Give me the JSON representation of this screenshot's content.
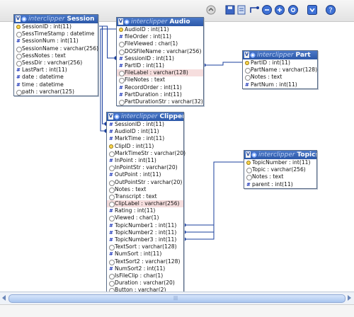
{
  "toolbar": {
    "icons": [
      "refresh-icon",
      "save-icon",
      "export-icon",
      "relation-icon",
      "zoom-out-icon",
      "zoom-in-icon",
      "zoom-reset-icon",
      "options-icon",
      "help-icon"
    ]
  },
  "colors": {
    "header_top": "#4a78c8",
    "header_bottom": "#2c58a8",
    "relation_line": "#1a3f9e",
    "highlight_row": "#f6dede"
  },
  "tables": {
    "session": {
      "db": "interclipper",
      "name": "Session",
      "columns": [
        {
          "icon": "key",
          "text": "SessionID : int(11)"
        },
        {
          "icon": "circle",
          "text": "SessTimeStamp : datetime"
        },
        {
          "icon": "hash",
          "text": "SessionNum : int(11)"
        },
        {
          "icon": "circle",
          "text": "SessionName : varchar(256)"
        },
        {
          "icon": "circle",
          "text": "SessNotes : text"
        },
        {
          "icon": "circle",
          "text": "SessDir : varchar(256)"
        },
        {
          "icon": "hash",
          "text": "LastPart : int(11)"
        },
        {
          "icon": "hash",
          "text": "date : datetime"
        },
        {
          "icon": "hash",
          "text": "time : datetime"
        },
        {
          "icon": "circle",
          "text": "path : varchar(125)"
        }
      ]
    },
    "audio": {
      "db": "interclipper",
      "name": "Audio",
      "columns": [
        {
          "icon": "key",
          "text": "AudioID : int(11)"
        },
        {
          "icon": "hash",
          "text": "fileOrder : int(11)"
        },
        {
          "icon": "circle",
          "text": "FileViewed : char(1)"
        },
        {
          "icon": "circle",
          "text": "DOSFileName : varchar(256)"
        },
        {
          "icon": "hash",
          "text": "SessionID : int(11)"
        },
        {
          "icon": "hash",
          "text": "PartID : int(11)"
        },
        {
          "icon": "circle",
          "text": "FileLabel : varchar(128)",
          "hl": true
        },
        {
          "icon": "circle",
          "text": "FileNotes : text"
        },
        {
          "icon": "hash",
          "text": "RecordOrder : int(11)"
        },
        {
          "icon": "hash",
          "text": "PartDuration : int(11)"
        },
        {
          "icon": "circle",
          "text": "PartDurationStr : varchar(32)"
        }
      ]
    },
    "part": {
      "db": "interclipper",
      "name": "Part",
      "columns": [
        {
          "icon": "key",
          "text": "PartID : int(11)"
        },
        {
          "icon": "circle",
          "text": "PartName : varchar(128)"
        },
        {
          "icon": "circle",
          "text": "Notes : text"
        },
        {
          "icon": "hash",
          "text": "PartNum : int(11)"
        }
      ]
    },
    "clipper": {
      "db": "interclipper",
      "name": "Clipper",
      "columns": [
        {
          "icon": "hash",
          "text": "SessionID : int(11)"
        },
        {
          "icon": "hash",
          "text": "AudioID : int(11)"
        },
        {
          "icon": "hash",
          "text": "MarkTime : int(11)"
        },
        {
          "icon": "key",
          "text": "ClipID : int(11)"
        },
        {
          "icon": "circle",
          "text": "MarkTimeStr : varchar(20)"
        },
        {
          "icon": "hash",
          "text": "InPoint : int(11)"
        },
        {
          "icon": "circle",
          "text": "InPointStr : varchar(20)"
        },
        {
          "icon": "hash",
          "text": "OutPoint : int(11)"
        },
        {
          "icon": "circle",
          "text": "OutPointStr : varchar(20)"
        },
        {
          "icon": "circle",
          "text": "Notes : text"
        },
        {
          "icon": "circle",
          "text": "Transcript : text"
        },
        {
          "icon": "circle",
          "text": "ClipLabel : varchar(256)",
          "hl": true
        },
        {
          "icon": "hash",
          "text": "Rating : int(11)"
        },
        {
          "icon": "circle",
          "text": "Viewed : char(1)"
        },
        {
          "icon": "hash",
          "text": "TopicNumber1 : int(11)"
        },
        {
          "icon": "hash",
          "text": "TopicNumber2 : int(11)"
        },
        {
          "icon": "hash",
          "text": "TopicNumber3 : int(11)"
        },
        {
          "icon": "circle",
          "text": "TextSort : varchar(128)"
        },
        {
          "icon": "hash",
          "text": "NumSort : int(11)"
        },
        {
          "icon": "circle",
          "text": "TextSort2 : varchar(128)"
        },
        {
          "icon": "hash",
          "text": "NumSort2 : int(11)"
        },
        {
          "icon": "circle",
          "text": "IsFileClip : char(1)"
        },
        {
          "icon": "circle",
          "text": "Duration : varchar(20)"
        },
        {
          "icon": "circle",
          "text": "Button : varchar(2)"
        }
      ]
    },
    "topics": {
      "db": "interclipper",
      "name": "Topics",
      "columns": [
        {
          "icon": "key",
          "text": "TopicNumber : int(11)"
        },
        {
          "icon": "circle",
          "text": "Topic : varchar(256)"
        },
        {
          "icon": "circle",
          "text": "Notes : text"
        },
        {
          "icon": "hash",
          "text": "parent : int(11)"
        }
      ]
    }
  },
  "relations": [
    {
      "from": "audio.SessionID",
      "to": "session.SessionID"
    },
    {
      "from": "audio.PartID",
      "to": "part.PartID"
    },
    {
      "from": "clipper.SessionID",
      "to": "session.SessionID"
    },
    {
      "from": "clipper.AudioID",
      "to": "audio.AudioID"
    },
    {
      "from": "clipper.TopicNumber1",
      "to": "topics.TopicNumber"
    },
    {
      "from": "clipper.TopicNumber2",
      "to": "topics.TopicNumber"
    },
    {
      "from": "clipper.TopicNumber3",
      "to": "topics.TopicNumber"
    }
  ]
}
